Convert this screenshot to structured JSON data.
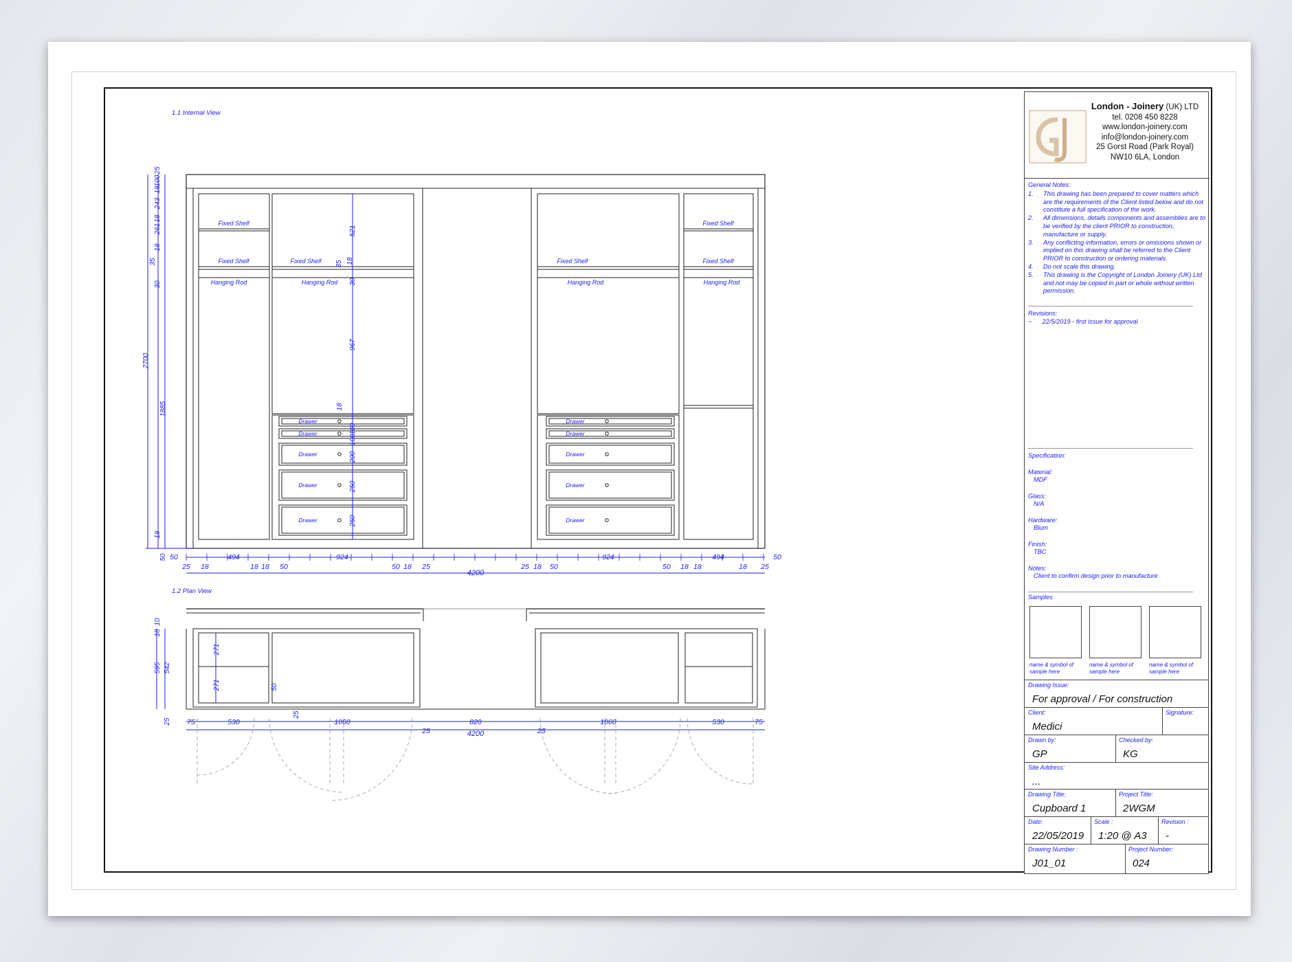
{
  "views": {
    "internal": "1.1 Internal View",
    "plan": "1.2 Plan View"
  },
  "labels": {
    "fixed_shelf": "Fixed Shelf",
    "hanging_rod": "Hanging Rod",
    "drawer": "Drawer"
  },
  "elevation_dims": {
    "left_stack": [
      "25",
      "100",
      "18",
      "243",
      "18",
      "261",
      "18",
      "35",
      "30",
      "2700",
      "1885",
      "18",
      "50"
    ],
    "center_vertical": [
      "521",
      "35",
      "18",
      "30",
      "967",
      "18",
      "100",
      "100",
      "200",
      "250",
      "250"
    ],
    "bottom_row": [
      "50",
      "25",
      "18",
      "494",
      "18",
      "18",
      "50",
      "924",
      "50",
      "18",
      "25",
      "25",
      "18",
      "50",
      "924",
      "50",
      "18",
      "18",
      "494",
      "18",
      "25",
      "50"
    ],
    "overall": "4200"
  },
  "plan_dims": {
    "left_stack": [
      "10",
      "18",
      "595",
      "542",
      "25"
    ],
    "inner": [
      "271",
      "271",
      "50",
      "25"
    ],
    "bottom_row": [
      "75",
      "530",
      "1060",
      "25",
      "820",
      "25",
      "1060",
      "530",
      "75"
    ],
    "overall": "4200"
  },
  "title_block": {
    "company": {
      "name_bold": "London - Joinery",
      "name_rest": " (UK) LTD",
      "tel": "tel. 0208 450 8228",
      "web": "www.london-joinery.com",
      "email": "info@london-joinery.com",
      "address1": "25 Gorst Road (Park Royal)",
      "address2": "NW10 6LA, London"
    },
    "general_notes_heading": "General Notes:",
    "notes": [
      {
        "n": "1.",
        "text": "This drawing has been prepared to cover matters which are the requirements of the Client listed below and do not constitute a full specification of the work."
      },
      {
        "n": "2.",
        "text": "All dimensions, details components and assemblies are to be verified by the client PRIOR to construction, manufacture or supply."
      },
      {
        "n": "3.",
        "text": "Any conflicting information, errors or omissions shown or implied on this drawing shall be referred to the Client PRIOR to construction or ordering materials."
      },
      {
        "n": "4.",
        "text": "Do not scale this drawing."
      },
      {
        "n": "5.",
        "text": "This drawing is the Copyright of London Joinery (UK) Ltd and not may be copied in part or whole without written permission."
      }
    ],
    "revisions_heading": "Revisions:",
    "revision_entry": "~      22/5/2019 - first issue for approval",
    "specification_heading": "Specification:",
    "spec": [
      {
        "label": "Material:",
        "value": "MDF"
      },
      {
        "label": "Glass:",
        "value": "N/A"
      },
      {
        "label": "Hardware:",
        "value": "Blum"
      },
      {
        "label": "Finish:",
        "value": "TBC"
      },
      {
        "label": "Notes:",
        "value": "Client to confirm design prior to manufacture"
      }
    ],
    "samples_heading": "Samples",
    "sample_caption": "name & symbol of sample here",
    "drawing_issue_label": "Drawing Issue:",
    "drawing_issue": "For approval / For construction",
    "client_label": "Client:",
    "client": "Medici",
    "signature_label": "Signature:",
    "drawn_by_label": "Drawn by:",
    "drawn_by": "GP",
    "checked_by_label": "Checked  by:",
    "checked_by": "KG",
    "site_address_label": "Site Address:",
    "site_address": "...",
    "drawing_title_label": "Drawing Title:",
    "drawing_title": "Cupboard 1",
    "project_title_label": "Project Title:",
    "project_title": "2WGM",
    "date_label": "Date:",
    "date": "22/05/2019",
    "scale_label": "Scale :",
    "scale": "1:20 @ A3",
    "revision_label": "Revision :",
    "revision": "-",
    "drawing_number_label": "Drawing Number :",
    "drawing_number": "J01_01",
    "project_number_label": "Project Number:",
    "project_number": "024"
  },
  "colors": {
    "ink": "#222222",
    "dim": "#1a1aff",
    "logo": "#d9c3a6"
  }
}
